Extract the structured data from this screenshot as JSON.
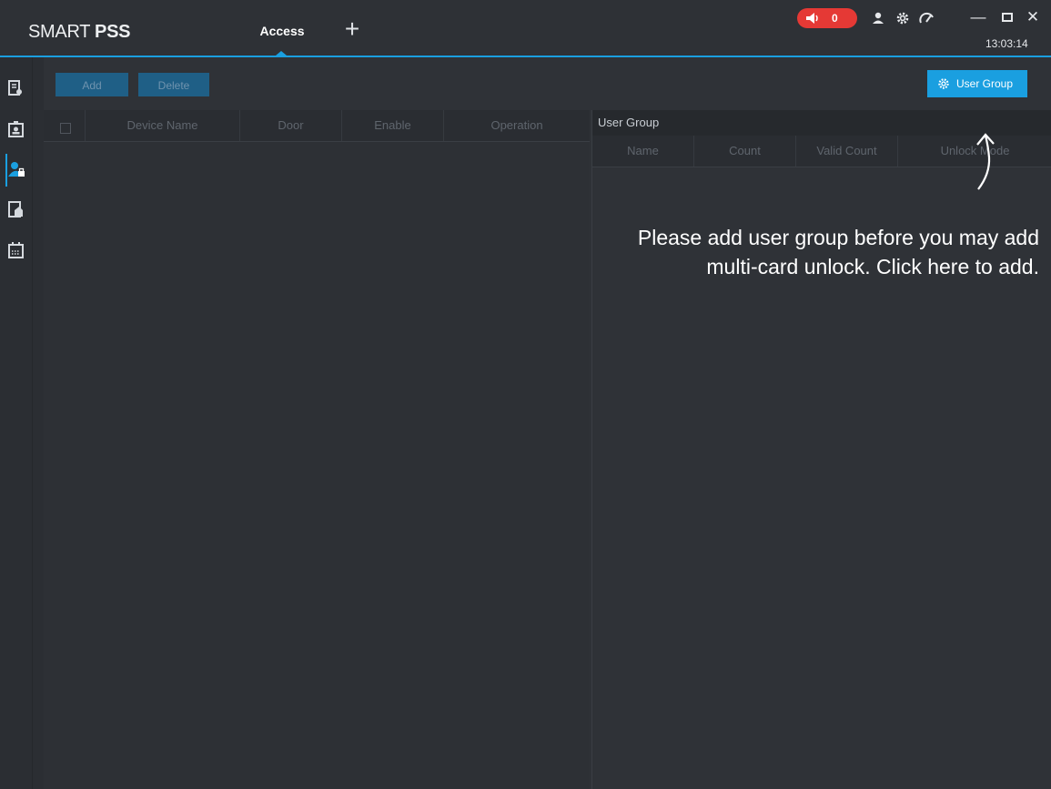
{
  "app": {
    "brand_light": "SMART",
    "brand_bold": "PSS",
    "active_tab": "Access",
    "add_tab_glyph": "+",
    "alarm_count": "0",
    "clock": "13:03:14",
    "icons": [
      "speaker-icon",
      "user-icon",
      "gear-icon",
      "performance-icon"
    ],
    "window_controls": [
      "minimize",
      "maximize",
      "close"
    ]
  },
  "rail": {
    "items": [
      {
        "name": "device-config",
        "icon": "device-config-icon",
        "active": false
      },
      {
        "name": "person",
        "icon": "person-card-icon",
        "active": false
      },
      {
        "name": "access-user",
        "icon": "user-lock-icon",
        "active": true
      },
      {
        "name": "door-group",
        "icon": "door-config-icon",
        "active": false
      },
      {
        "name": "schedule",
        "icon": "calendar-icon",
        "active": false
      }
    ]
  },
  "toolbar": {
    "add_label": "Add",
    "delete_label": "Delete",
    "user_group_label": "User Group"
  },
  "device_table": {
    "columns": [
      "Device Name",
      "Door",
      "Enable",
      "Operation"
    ],
    "rows": []
  },
  "user_group_panel": {
    "title": "User Group",
    "columns": [
      "Name",
      "Count",
      "Valid Count",
      "Unlock Mode"
    ],
    "rows": []
  },
  "hint": {
    "line1": "Please add user group before you may add",
    "line2": "multi-card unlock. Click here to add."
  },
  "colors": {
    "accent": "#1a9fe0",
    "alarm": "#e53935",
    "background": "#2f3237"
  }
}
